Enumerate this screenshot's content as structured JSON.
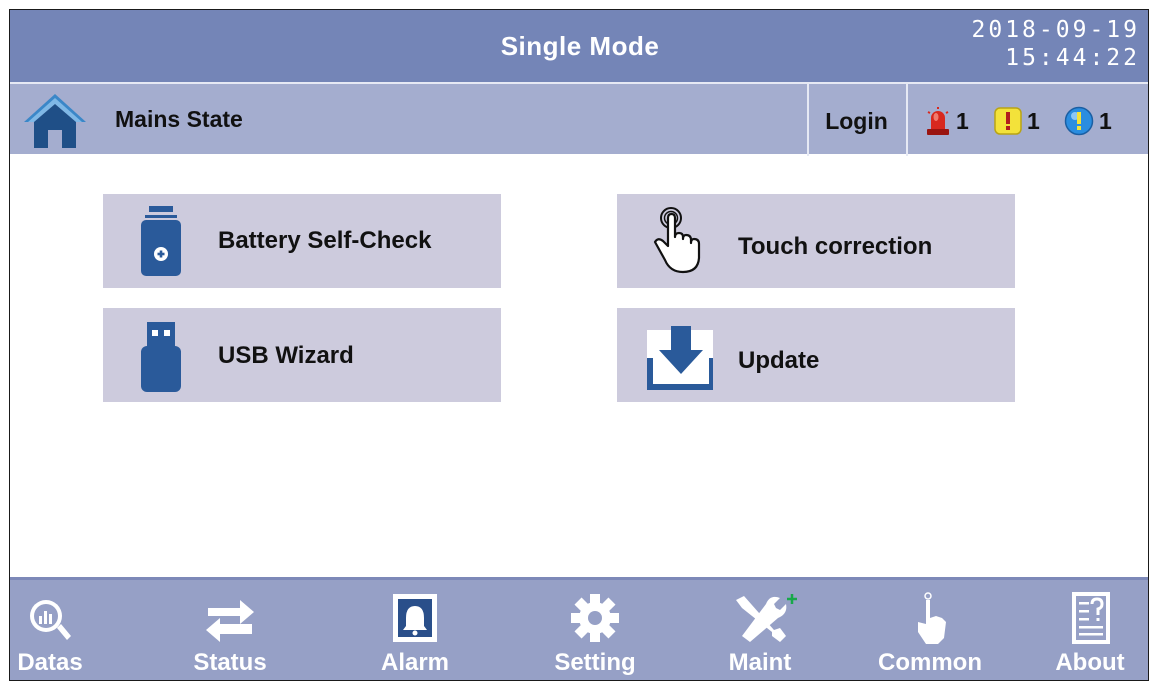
{
  "header": {
    "title": "Single Mode",
    "date": "2018-09-19",
    "time": "15:44:22"
  },
  "status_bar": {
    "state": "Mains State",
    "login_label": "Login",
    "alarms": [
      {
        "icon": "red-alarm-light-icon",
        "count": "1"
      },
      {
        "icon": "yellow-warning-icon",
        "count": "1"
      },
      {
        "icon": "blue-info-icon",
        "count": "1"
      }
    ]
  },
  "buttons": [
    {
      "icon": "battery-icon",
      "label": "Battery Self-Check"
    },
    {
      "icon": "touch-hand-icon",
      "label": "Touch correction"
    },
    {
      "icon": "usb-icon",
      "label": "USB Wizard"
    },
    {
      "icon": "download-icon",
      "label": "Update"
    }
  ],
  "nav": [
    {
      "icon": "magnifier-chart-icon",
      "label": "Datas"
    },
    {
      "icon": "swap-arrows-icon",
      "label": "Status"
    },
    {
      "icon": "bell-icon",
      "label": "Alarm"
    },
    {
      "icon": "gear-icon",
      "label": "Setting"
    },
    {
      "icon": "tools-icon",
      "label": "Maint"
    },
    {
      "icon": "pointer-hand-icon",
      "label": "Common"
    },
    {
      "icon": "help-document-icon",
      "label": "About"
    }
  ],
  "colors": {
    "title_bar": "#7485b7",
    "status_bar": "#a4adcf",
    "button_bg": "#cdcbdd",
    "nav_bar": "#96a0c6",
    "icon_blue": "#2a5a9a"
  }
}
